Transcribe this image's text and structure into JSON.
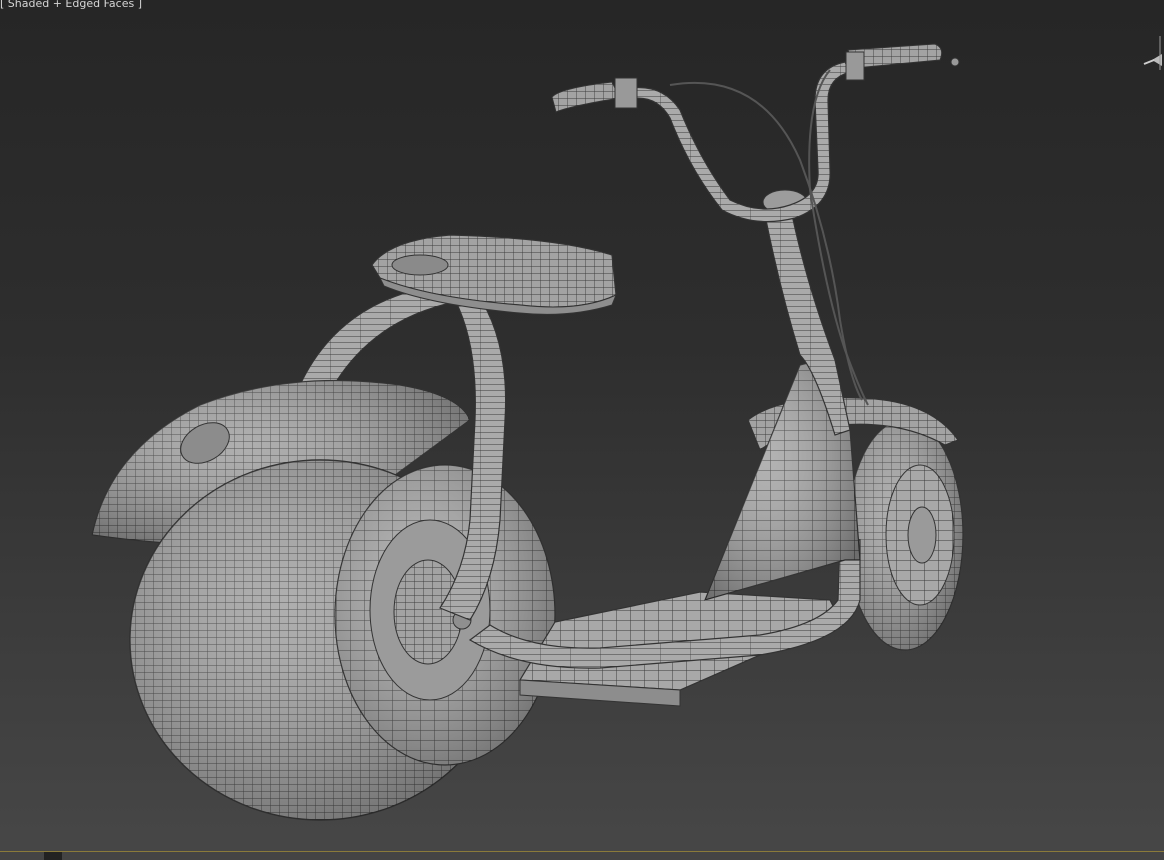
{
  "viewport": {
    "label": "[ Shaded + Edged Faces ]",
    "shading_mode": "Shaded + Edged Faces",
    "background_top": "#262626",
    "background_bottom": "#474747",
    "mesh_color": "#a9a9a9",
    "wire_color": "#3a3a3a",
    "object": "scooter-wireframe-model"
  },
  "gizmo": {
    "icon": "view-cube-icon"
  }
}
